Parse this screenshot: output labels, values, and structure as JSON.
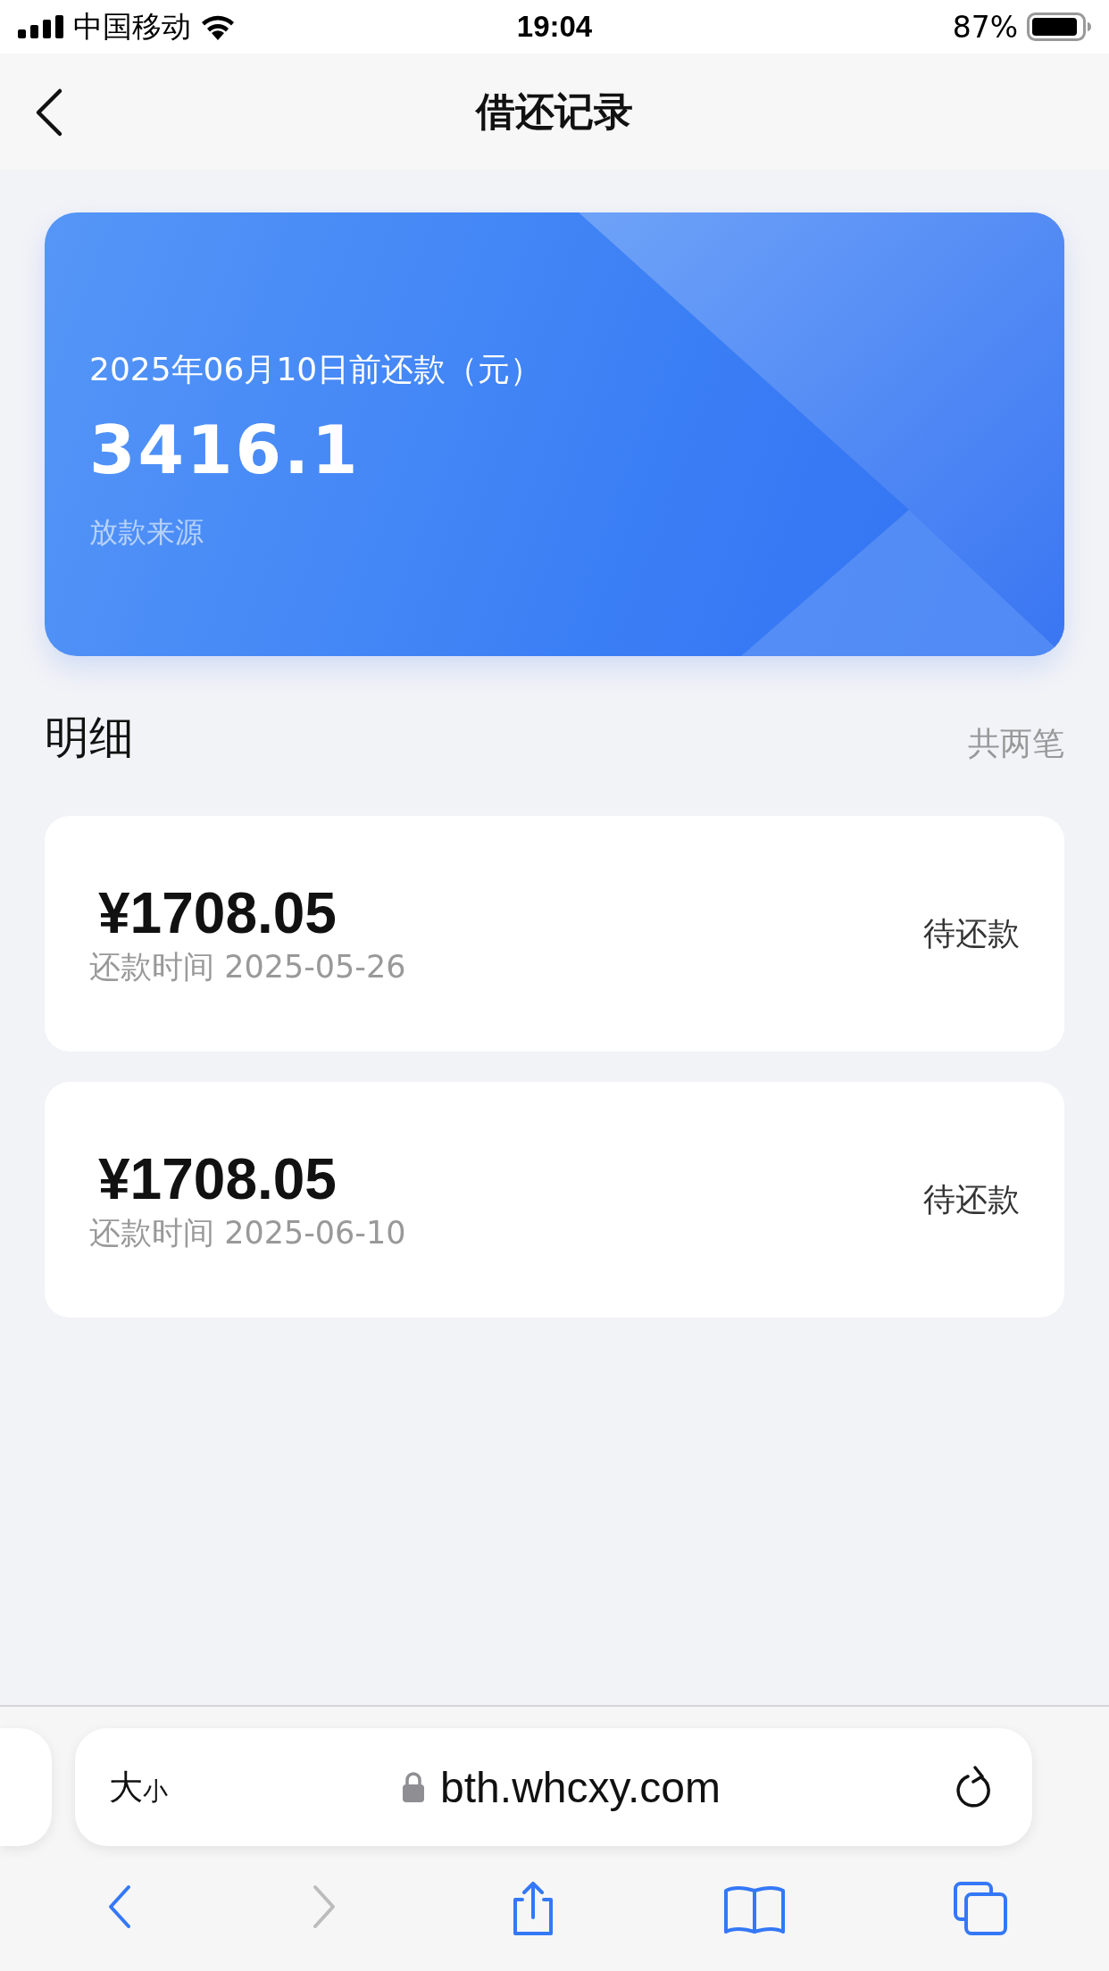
{
  "status_bar": {
    "carrier": "中国移动",
    "time": "19:04",
    "battery": "87%"
  },
  "nav": {
    "title": "借还记录"
  },
  "summary": {
    "subtitle": "2025年06月10日前还款（元）",
    "amount": "3416.1",
    "source": "放款来源"
  },
  "details": {
    "title": "明细",
    "count": "共两笔",
    "records": [
      {
        "amount": "¥1708.05",
        "date_label": "还款时间 2025-05-26",
        "status": "待还款"
      },
      {
        "amount": "¥1708.05",
        "date_label": "还款时间 2025-06-10",
        "status": "待还款"
      }
    ]
  },
  "browser": {
    "text_size_large": "大",
    "text_size_small": "小",
    "url": "bth.whcxy.com",
    "toolbar": [
      {
        "kind": "back",
        "disabled": false
      },
      {
        "kind": "forward",
        "disabled": true
      },
      {
        "kind": "share",
        "disabled": false
      },
      {
        "kind": "bookmarks",
        "disabled": false
      },
      {
        "kind": "tabs",
        "disabled": false
      }
    ]
  }
}
